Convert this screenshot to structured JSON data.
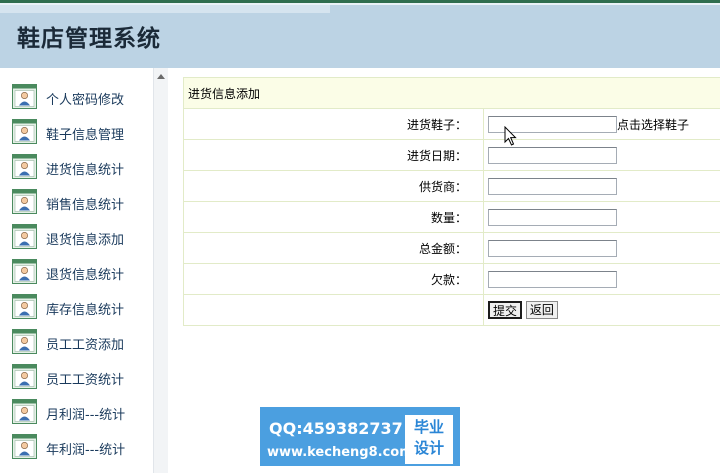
{
  "header": {
    "title": "鞋店管理系统"
  },
  "sidebar": {
    "items": [
      {
        "label": "个人密码修改"
      },
      {
        "label": "鞋子信息管理"
      },
      {
        "label": "进货信息统计"
      },
      {
        "label": "销售信息统计"
      },
      {
        "label": "退货信息添加"
      },
      {
        "label": "退货信息统计"
      },
      {
        "label": "库存信息统计"
      },
      {
        "label": "员工工资添加"
      },
      {
        "label": "员工工资统计"
      },
      {
        "label": "月利润---统计"
      },
      {
        "label": "年利润---统计"
      }
    ]
  },
  "form": {
    "title": "进货信息添加",
    "fields": [
      {
        "label": "进货鞋子：",
        "value": ""
      },
      {
        "label": "进货日期：",
        "value": ""
      },
      {
        "label": "供货商：",
        "value": ""
      },
      {
        "label": "数量：",
        "value": ""
      },
      {
        "label": "总金额：",
        "value": ""
      },
      {
        "label": "欠款：",
        "value": ""
      }
    ],
    "select_shoe_hint": "点击选择鞋子",
    "submit_label": "提交",
    "back_label": "返回"
  },
  "watermark": {
    "qq": "QQ:459382737",
    "url": "www.kecheng8.com",
    "badge_line1": "毕业",
    "badge_line2": "设计"
  }
}
